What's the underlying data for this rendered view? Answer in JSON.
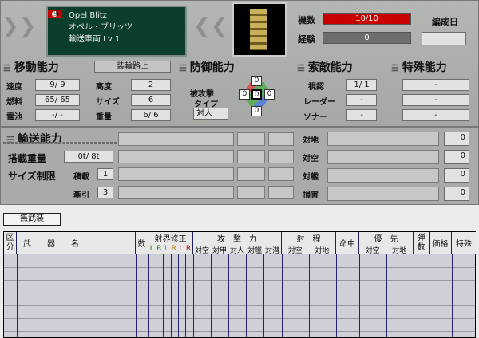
{
  "unit": {
    "name_en": "Opel Blitz",
    "name_jp": "オペル・ブリッツ",
    "class": "輸送車両 Lv 1"
  },
  "counts": {
    "count_label": "機数",
    "count_value": "10/10",
    "exp_label": "経験",
    "exp_value": "0",
    "formation_label": "編成日",
    "formation_value": ""
  },
  "mobility": {
    "header": "移動能力",
    "mode_button": "装輪路上",
    "speed_label": "速度",
    "speed_value": "9/ 9",
    "fuel_label": "燃料",
    "fuel_value": "65/ 65",
    "battery_label": "電池",
    "battery_value": "-/ -",
    "altitude_label": "高度",
    "altitude_value": "2",
    "size_label": "サイズ",
    "size_value": "6",
    "weight_label": "重量",
    "weight_value": "6/ 6"
  },
  "defense": {
    "header": "防御能力",
    "attacked_type_label": "被攻撃タイプ",
    "attacked_type_label_1": "被攻撃",
    "attacked_type_label_2": "タイプ",
    "target_type": "対人",
    "armor_top": "0",
    "armor_left": "0",
    "armor_center": "0",
    "armor_right": "0",
    "armor_bottom": "0"
  },
  "search": {
    "header": "索敵能力",
    "sight_label": "視認",
    "sight_value": "1/ 1",
    "radar_label": "レーダー",
    "radar_value": "-",
    "sonar_label": "ソナー",
    "sonar_value": "-"
  },
  "special": {
    "header": "特殊能力",
    "rows": [
      "-",
      "-",
      "-"
    ]
  },
  "transport": {
    "header": "輸送能力",
    "load_label": "搭載重量",
    "load_value": "0t/ 8t",
    "size_limit_label": "サイズ制限",
    "loaded_label": "積載",
    "loaded_value": "1",
    "tow_label": "牽引",
    "tow_value": "3"
  },
  "attack_targets": {
    "ground_label": "対地",
    "ground_value": "0",
    "air_label": "対空",
    "air_value": "0",
    "ship_label": "対艦",
    "ship_value": "0",
    "damage_label": "損害",
    "damage_value": "0"
  },
  "tabs": {
    "unarmed_label": "無武装"
  },
  "table": {
    "cols": {
      "kubun": "区分",
      "weapon": "武　　器　　名",
      "count": "数",
      "range_mod": "射界修正",
      "range_lr": [
        "L",
        "R",
        "L",
        "R",
        "L",
        "R"
      ],
      "attack": "攻　撃　力",
      "attack_sub": [
        "対空",
        "対甲",
        "対人",
        "対艦",
        "対潜"
      ],
      "range": "射　程",
      "range_sub": [
        "対空",
        "対地"
      ],
      "accuracy": "命中",
      "priority": "優　先",
      "priority_sub": [
        "対空",
        "対地"
      ],
      "ammo": "弾数",
      "price": "価格",
      "special": "特殊"
    }
  },
  "colors": {
    "accent_red": "#c80000",
    "panel_green": "#0b3e2c",
    "grid_bg": "#cfd0d7"
  },
  "icons": {
    "flag": "flag-icon",
    "wings": "wings-emblem-icon",
    "portrait": "unit-portrait"
  }
}
